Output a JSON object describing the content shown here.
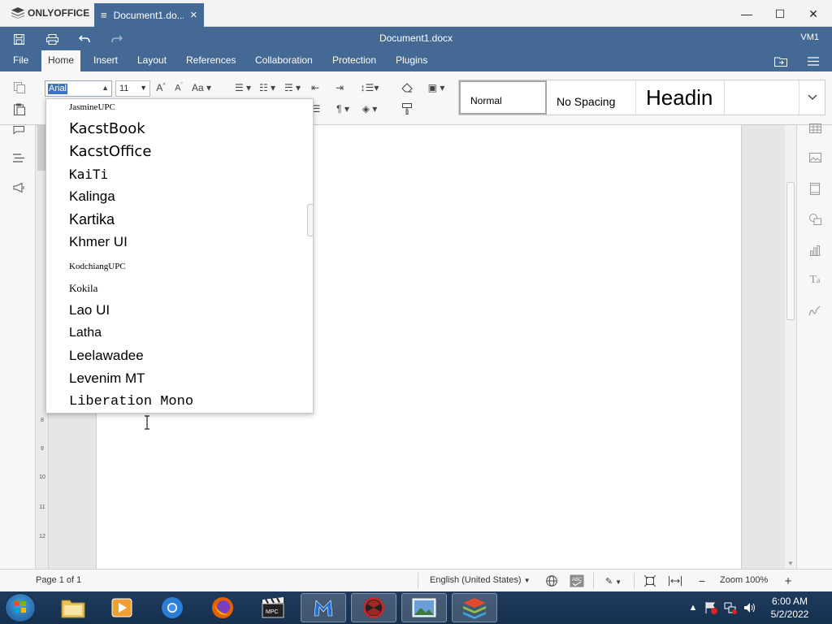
{
  "titlebar": {
    "app_name": "ONLYOFFICE",
    "tab_title": "Document1.do...",
    "min_glyph": "—",
    "max_glyph": "☐",
    "close_glyph": "✕"
  },
  "header": {
    "doc_name": "Document1.docx",
    "user": "VM1"
  },
  "menu": {
    "tabs": [
      "File",
      "Home",
      "Insert",
      "Layout",
      "References",
      "Collaboration",
      "Protection",
      "Plugins"
    ],
    "active": "Home"
  },
  "toolbar": {
    "font_name": "Arial",
    "font_size": "11",
    "styles": [
      "Normal",
      "No Spacing",
      "Headin"
    ]
  },
  "font_list": [
    {
      "name": "JasmineUPC",
      "family": "\"Liberation Serif\", serif",
      "size": 11
    },
    {
      "name": "KacstBook",
      "family": "\"DejaVu Sans\", sans-serif",
      "size": 18
    },
    {
      "name": "KacstOffice",
      "family": "\"DejaVu Sans\", sans-serif",
      "size": 18
    },
    {
      "name": "KaiTi",
      "family": "\"DejaVu Sans Mono\", monospace",
      "size": 16
    },
    {
      "name": "Kalinga",
      "family": "\"Liberation Sans\", sans-serif",
      "size": 17
    },
    {
      "name": "Kartika",
      "family": "\"Liberation Sans\", sans-serif",
      "size": 18
    },
    {
      "name": "Khmer UI",
      "family": "\"Liberation Sans\", sans-serif",
      "size": 17
    },
    {
      "name": "KodchiangUPC",
      "family": "\"Liberation Serif\", serif",
      "size": 11
    },
    {
      "name": "Kokila",
      "family": "\"Liberation Serif\", serif",
      "size": 13
    },
    {
      "name": "Lao UI",
      "family": "\"Liberation Sans\", sans-serif",
      "size": 17
    },
    {
      "name": "Latha",
      "family": "\"Liberation Sans\", sans-serif",
      "size": 16
    },
    {
      "name": "Leelawadee",
      "family": "\"Liberation Sans\", sans-serif",
      "size": 17
    },
    {
      "name": "Levenim MT",
      "family": "\"Liberation Sans\", sans-serif",
      "size": 17
    },
    {
      "name": "Liberation Mono",
      "family": "\"Liberation Mono\", monospace",
      "size": 17
    }
  ],
  "statusbar": {
    "page": "Page 1 of 1",
    "language": "English (United States)",
    "zoom": "Zoom 100%"
  },
  "taskbar": {
    "time": "6:00 AM",
    "date": "5/2/2022"
  },
  "colors": {
    "brand": "#446995",
    "selection": "#3b74c4"
  }
}
